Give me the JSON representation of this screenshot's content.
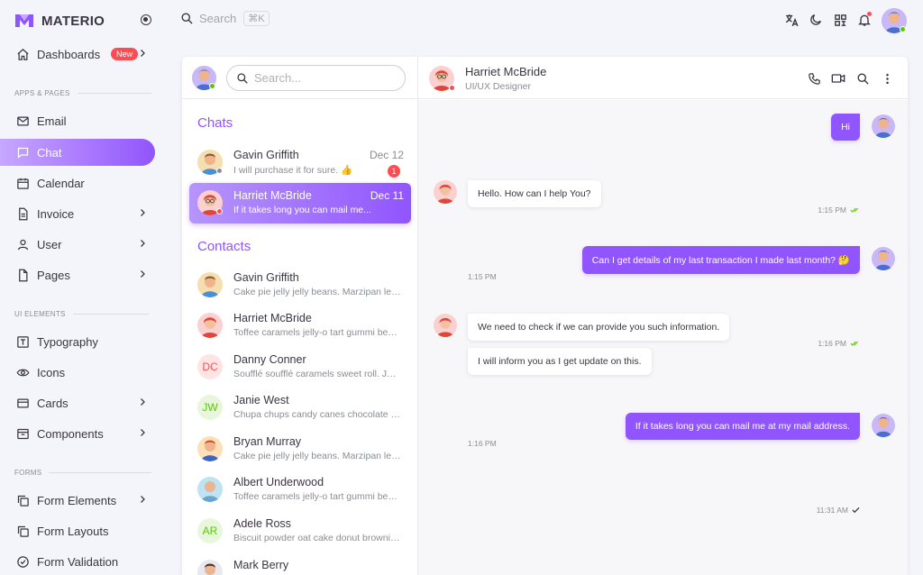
{
  "brand": {
    "name": "MATERIO"
  },
  "topbar": {
    "search_placeholder": "Search",
    "shortcut": "⌘K"
  },
  "sidebar": {
    "dashboards": {
      "label": "Dashboards",
      "badge": "New"
    },
    "section_apps": "APPS & PAGES",
    "email": "Email",
    "chat": "Chat",
    "calendar": "Calendar",
    "invoice": "Invoice",
    "user": "User",
    "pages": "Pages",
    "section_ui": "UI ELEMENTS",
    "typography": "Typography",
    "icons": "Icons",
    "cards": "Cards",
    "components": "Components",
    "section_forms": "FORMS",
    "form_elements": "Form Elements",
    "form_layouts": "Form Layouts",
    "form_validation": "Form Validation"
  },
  "left_pane": {
    "search_placeholder": "Search...",
    "chats_title": "Chats",
    "contacts_title": "Contacts",
    "chats": [
      {
        "name": "Gavin Griffith",
        "preview": "I will purchase it for sure. 👍",
        "date": "Dec 12",
        "unread": "1"
      },
      {
        "name": "Harriet McBride",
        "preview": "If it takes long you can mail me...",
        "date": "Dec 11"
      }
    ],
    "contacts": [
      {
        "name": "Gavin Griffith",
        "preview": "Cake pie jelly jelly beans. Marzipan lemon drops"
      },
      {
        "name": "Harriet McBride",
        "preview": "Toffee caramels jelly-o tart gummi bears cake"
      },
      {
        "name": "Danny Conner",
        "initials": "DC",
        "preview": "Soufflé soufflé caramels sweet roll. Jelly lollipop"
      },
      {
        "name": "Janie West",
        "initials": "JW",
        "preview": "Chupa chups candy canes chocolate bar marshmallow"
      },
      {
        "name": "Bryan Murray",
        "preview": "Cake pie jelly jelly beans. Marzipan lemon drops"
      },
      {
        "name": "Albert Underwood",
        "preview": "Toffee caramels jelly-o tart gummi bears cake"
      },
      {
        "name": "Adele Ross",
        "initials": "AR",
        "preview": "Biscuit powder oat cake donut brownie ice cream"
      },
      {
        "name": "Mark Berry"
      }
    ]
  },
  "conversation": {
    "name": "Harriet McBride",
    "role": "UI/UX Designer",
    "messages": [
      {
        "text": "Hi",
        "time": "1:15 PM"
      },
      {
        "text": "Hello. How can I help You?",
        "time": "1:15 PM"
      },
      {
        "text": "Can I get details of my last transaction I made last month? 🤔",
        "time": "1:16 PM"
      },
      {
        "text": "We need to check if we can provide you such information.",
        "text2": "I will inform you as I get update on this.",
        "time": "1:16 PM"
      },
      {
        "text": "If it takes long you can mail me at my mail address.",
        "time": "11:31 AM"
      }
    ]
  },
  "colors": {
    "primary": "#9155fd",
    "error": "#ff4c51",
    "success": "#56ca00"
  }
}
